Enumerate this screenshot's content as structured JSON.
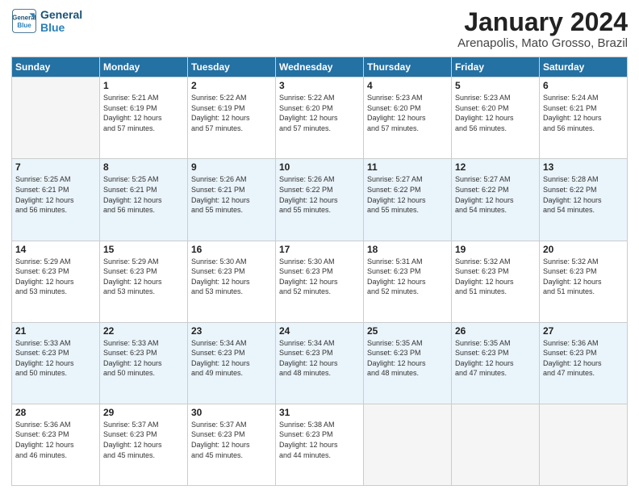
{
  "logo": {
    "line1": "General",
    "line2": "Blue"
  },
  "header": {
    "month": "January 2024",
    "location": "Arenapolis, Mato Grosso, Brazil"
  },
  "weekdays": [
    "Sunday",
    "Monday",
    "Tuesday",
    "Wednesday",
    "Thursday",
    "Friday",
    "Saturday"
  ],
  "weeks": [
    [
      {
        "day": "",
        "info": ""
      },
      {
        "day": "1",
        "info": "Sunrise: 5:21 AM\nSunset: 6:19 PM\nDaylight: 12 hours\nand 57 minutes."
      },
      {
        "day": "2",
        "info": "Sunrise: 5:22 AM\nSunset: 6:19 PM\nDaylight: 12 hours\nand 57 minutes."
      },
      {
        "day": "3",
        "info": "Sunrise: 5:22 AM\nSunset: 6:20 PM\nDaylight: 12 hours\nand 57 minutes."
      },
      {
        "day": "4",
        "info": "Sunrise: 5:23 AM\nSunset: 6:20 PM\nDaylight: 12 hours\nand 57 minutes."
      },
      {
        "day": "5",
        "info": "Sunrise: 5:23 AM\nSunset: 6:20 PM\nDaylight: 12 hours\nand 56 minutes."
      },
      {
        "day": "6",
        "info": "Sunrise: 5:24 AM\nSunset: 6:21 PM\nDaylight: 12 hours\nand 56 minutes."
      }
    ],
    [
      {
        "day": "7",
        "info": "Sunrise: 5:25 AM\nSunset: 6:21 PM\nDaylight: 12 hours\nand 56 minutes."
      },
      {
        "day": "8",
        "info": "Sunrise: 5:25 AM\nSunset: 6:21 PM\nDaylight: 12 hours\nand 56 minutes."
      },
      {
        "day": "9",
        "info": "Sunrise: 5:26 AM\nSunset: 6:21 PM\nDaylight: 12 hours\nand 55 minutes."
      },
      {
        "day": "10",
        "info": "Sunrise: 5:26 AM\nSunset: 6:22 PM\nDaylight: 12 hours\nand 55 minutes."
      },
      {
        "day": "11",
        "info": "Sunrise: 5:27 AM\nSunset: 6:22 PM\nDaylight: 12 hours\nand 55 minutes."
      },
      {
        "day": "12",
        "info": "Sunrise: 5:27 AM\nSunset: 6:22 PM\nDaylight: 12 hours\nand 54 minutes."
      },
      {
        "day": "13",
        "info": "Sunrise: 5:28 AM\nSunset: 6:22 PM\nDaylight: 12 hours\nand 54 minutes."
      }
    ],
    [
      {
        "day": "14",
        "info": "Sunrise: 5:29 AM\nSunset: 6:23 PM\nDaylight: 12 hours\nand 53 minutes."
      },
      {
        "day": "15",
        "info": "Sunrise: 5:29 AM\nSunset: 6:23 PM\nDaylight: 12 hours\nand 53 minutes."
      },
      {
        "day": "16",
        "info": "Sunrise: 5:30 AM\nSunset: 6:23 PM\nDaylight: 12 hours\nand 53 minutes."
      },
      {
        "day": "17",
        "info": "Sunrise: 5:30 AM\nSunset: 6:23 PM\nDaylight: 12 hours\nand 52 minutes."
      },
      {
        "day": "18",
        "info": "Sunrise: 5:31 AM\nSunset: 6:23 PM\nDaylight: 12 hours\nand 52 minutes."
      },
      {
        "day": "19",
        "info": "Sunrise: 5:32 AM\nSunset: 6:23 PM\nDaylight: 12 hours\nand 51 minutes."
      },
      {
        "day": "20",
        "info": "Sunrise: 5:32 AM\nSunset: 6:23 PM\nDaylight: 12 hours\nand 51 minutes."
      }
    ],
    [
      {
        "day": "21",
        "info": "Sunrise: 5:33 AM\nSunset: 6:23 PM\nDaylight: 12 hours\nand 50 minutes."
      },
      {
        "day": "22",
        "info": "Sunrise: 5:33 AM\nSunset: 6:23 PM\nDaylight: 12 hours\nand 50 minutes."
      },
      {
        "day": "23",
        "info": "Sunrise: 5:34 AM\nSunset: 6:23 PM\nDaylight: 12 hours\nand 49 minutes."
      },
      {
        "day": "24",
        "info": "Sunrise: 5:34 AM\nSunset: 6:23 PM\nDaylight: 12 hours\nand 48 minutes."
      },
      {
        "day": "25",
        "info": "Sunrise: 5:35 AM\nSunset: 6:23 PM\nDaylight: 12 hours\nand 48 minutes."
      },
      {
        "day": "26",
        "info": "Sunrise: 5:35 AM\nSunset: 6:23 PM\nDaylight: 12 hours\nand 47 minutes."
      },
      {
        "day": "27",
        "info": "Sunrise: 5:36 AM\nSunset: 6:23 PM\nDaylight: 12 hours\nand 47 minutes."
      }
    ],
    [
      {
        "day": "28",
        "info": "Sunrise: 5:36 AM\nSunset: 6:23 PM\nDaylight: 12 hours\nand 46 minutes."
      },
      {
        "day": "29",
        "info": "Sunrise: 5:37 AM\nSunset: 6:23 PM\nDaylight: 12 hours\nand 45 minutes."
      },
      {
        "day": "30",
        "info": "Sunrise: 5:37 AM\nSunset: 6:23 PM\nDaylight: 12 hours\nand 45 minutes."
      },
      {
        "day": "31",
        "info": "Sunrise: 5:38 AM\nSunset: 6:23 PM\nDaylight: 12 hours\nand 44 minutes."
      },
      {
        "day": "",
        "info": ""
      },
      {
        "day": "",
        "info": ""
      },
      {
        "day": "",
        "info": ""
      }
    ]
  ]
}
